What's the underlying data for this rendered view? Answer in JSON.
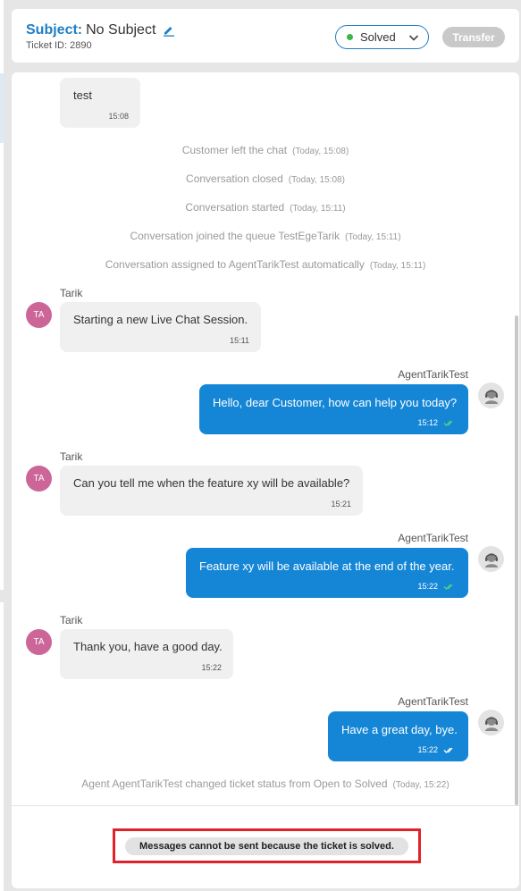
{
  "header": {
    "subject_label": "Subject:",
    "subject_value": "No Subject",
    "ticket_id": "Ticket ID: 2890",
    "status": "Solved",
    "transfer_label": "Transfer"
  },
  "messages": {
    "m0": {
      "text": "test",
      "time": "15:08"
    },
    "m1": {
      "sender": "Tarik",
      "initials": "TA",
      "text": "Starting a new Live Chat Session.",
      "time": "15:11"
    },
    "m2": {
      "sender": "AgentTarikTest",
      "text": "Hello, dear Customer, how can help you today?",
      "time": "15:12"
    },
    "m3": {
      "sender": "Tarik",
      "initials": "TA",
      "text": "Can you tell me when the feature xy will be available?",
      "time": "15:21"
    },
    "m4": {
      "sender": "AgentTarikTest",
      "text": "Feature xy will be available at the end of the year.",
      "time": "15:22"
    },
    "m5": {
      "sender": "Tarik",
      "initials": "TA",
      "text": "Thank you, have a good day.",
      "time": "15:22"
    },
    "m6": {
      "sender": "AgentTarikTest",
      "text": "Have a great day, bye.",
      "time": "15:22"
    }
  },
  "system": {
    "s1": {
      "text": "Customer left the chat",
      "time": "(Today, 15:08)"
    },
    "s2": {
      "text": "Conversation closed",
      "time": "(Today, 15:08)"
    },
    "s3": {
      "text": "Conversation started",
      "time": "(Today, 15:11)"
    },
    "s4": {
      "text": "Conversation joined the queue TestEgeTarik",
      "time": "(Today, 15:11)"
    },
    "s5": {
      "text": "Conversation assigned to AgentTarikTest automatically",
      "time": "(Today, 15:11)"
    },
    "s6": {
      "text": "Agent AgentTarikTest changed ticket status from Open to Solved",
      "time": "(Today, 15:22)"
    }
  },
  "footer": {
    "notice": "Messages cannot be sent because the ticket is solved."
  },
  "colors": {
    "accent": "#1f7fc4",
    "agent_bubble": "#1586d6",
    "customer_bubble": "#f0f0f0",
    "avatar": "#cc6699",
    "status_solved": "#3ab54a",
    "highlight_frame": "#e0232b"
  },
  "icons": {
    "edit": "pencil-icon",
    "dropdown": "chevron-down-icon",
    "read_receipt": "double-check-icon",
    "agent_avatar": "headset-agent-icon"
  }
}
